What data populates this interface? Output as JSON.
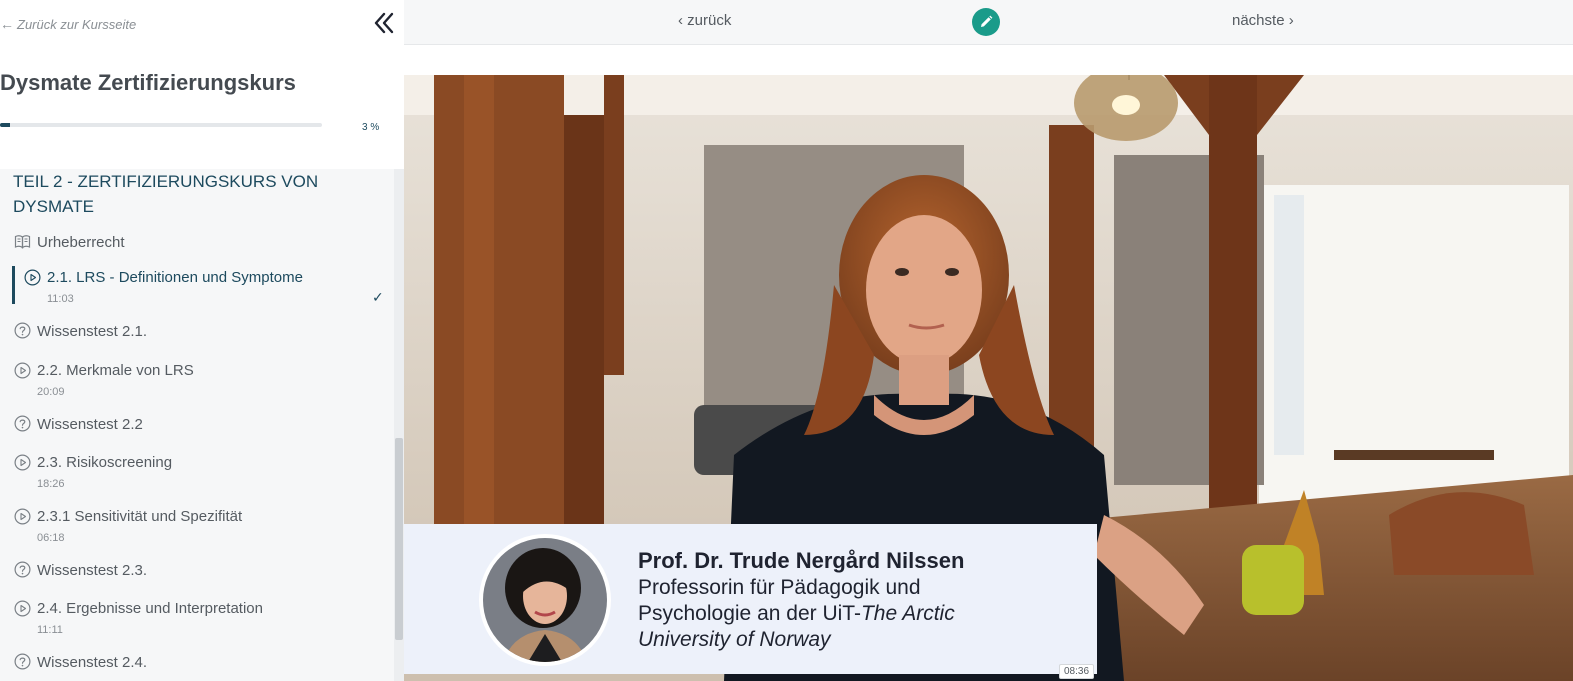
{
  "sidebar": {
    "back_label": "Zurück zur Kursseite",
    "course_title": "Dysmate Zertifizierungskurs",
    "progress_percent": 3,
    "progress_text": "3 %",
    "section_title": "TEIL 2 - ZERTIFIZIERUNGSKURS VON DYSMATE",
    "items": [
      {
        "type": "book",
        "label": "Urheberrecht",
        "duration": ""
      },
      {
        "type": "video",
        "label": "2.1. LRS - Definitionen und Symptome",
        "duration": "11:03",
        "active": true,
        "completed": true
      },
      {
        "type": "quiz",
        "label": "Wissenstest 2.1.",
        "duration": ""
      },
      {
        "type": "video",
        "label": "2.2. Merkmale von LRS",
        "duration": "20:09"
      },
      {
        "type": "quiz",
        "label": "Wissenstest 2.2",
        "duration": ""
      },
      {
        "type": "video",
        "label": "2.3. Risikoscreening",
        "duration": "18:26"
      },
      {
        "type": "video",
        "label": "2.3.1 Sensitivität und Spezifität",
        "duration": "06:18"
      },
      {
        "type": "quiz",
        "label": "Wissenstest 2.3.",
        "duration": ""
      },
      {
        "type": "video",
        "label": "2.4. Ergebnisse und Interpretation",
        "duration": "11:11"
      },
      {
        "type": "quiz",
        "label": "Wissenstest 2.4.",
        "duration": ""
      }
    ],
    "check_mark": "✓"
  },
  "topbar": {
    "prev_label": "zurück",
    "next_label": "nächste",
    "edit_icon": "pencil-icon"
  },
  "video": {
    "speaker_name": "Prof. Dr. Trude Nergård Nilssen",
    "speaker_role_line1": "Professorin für Pädagogik und",
    "speaker_role_line2": "Psychologie an der UiT-",
    "speaker_role_italic": "The Arctic",
    "speaker_role_line3": "University of Norway",
    "timestamp": "08:36"
  },
  "colors": {
    "accent": "#1d4a5e",
    "edit_button": "#1a9b8a",
    "sidebar_bg": "#f6f7f8"
  }
}
